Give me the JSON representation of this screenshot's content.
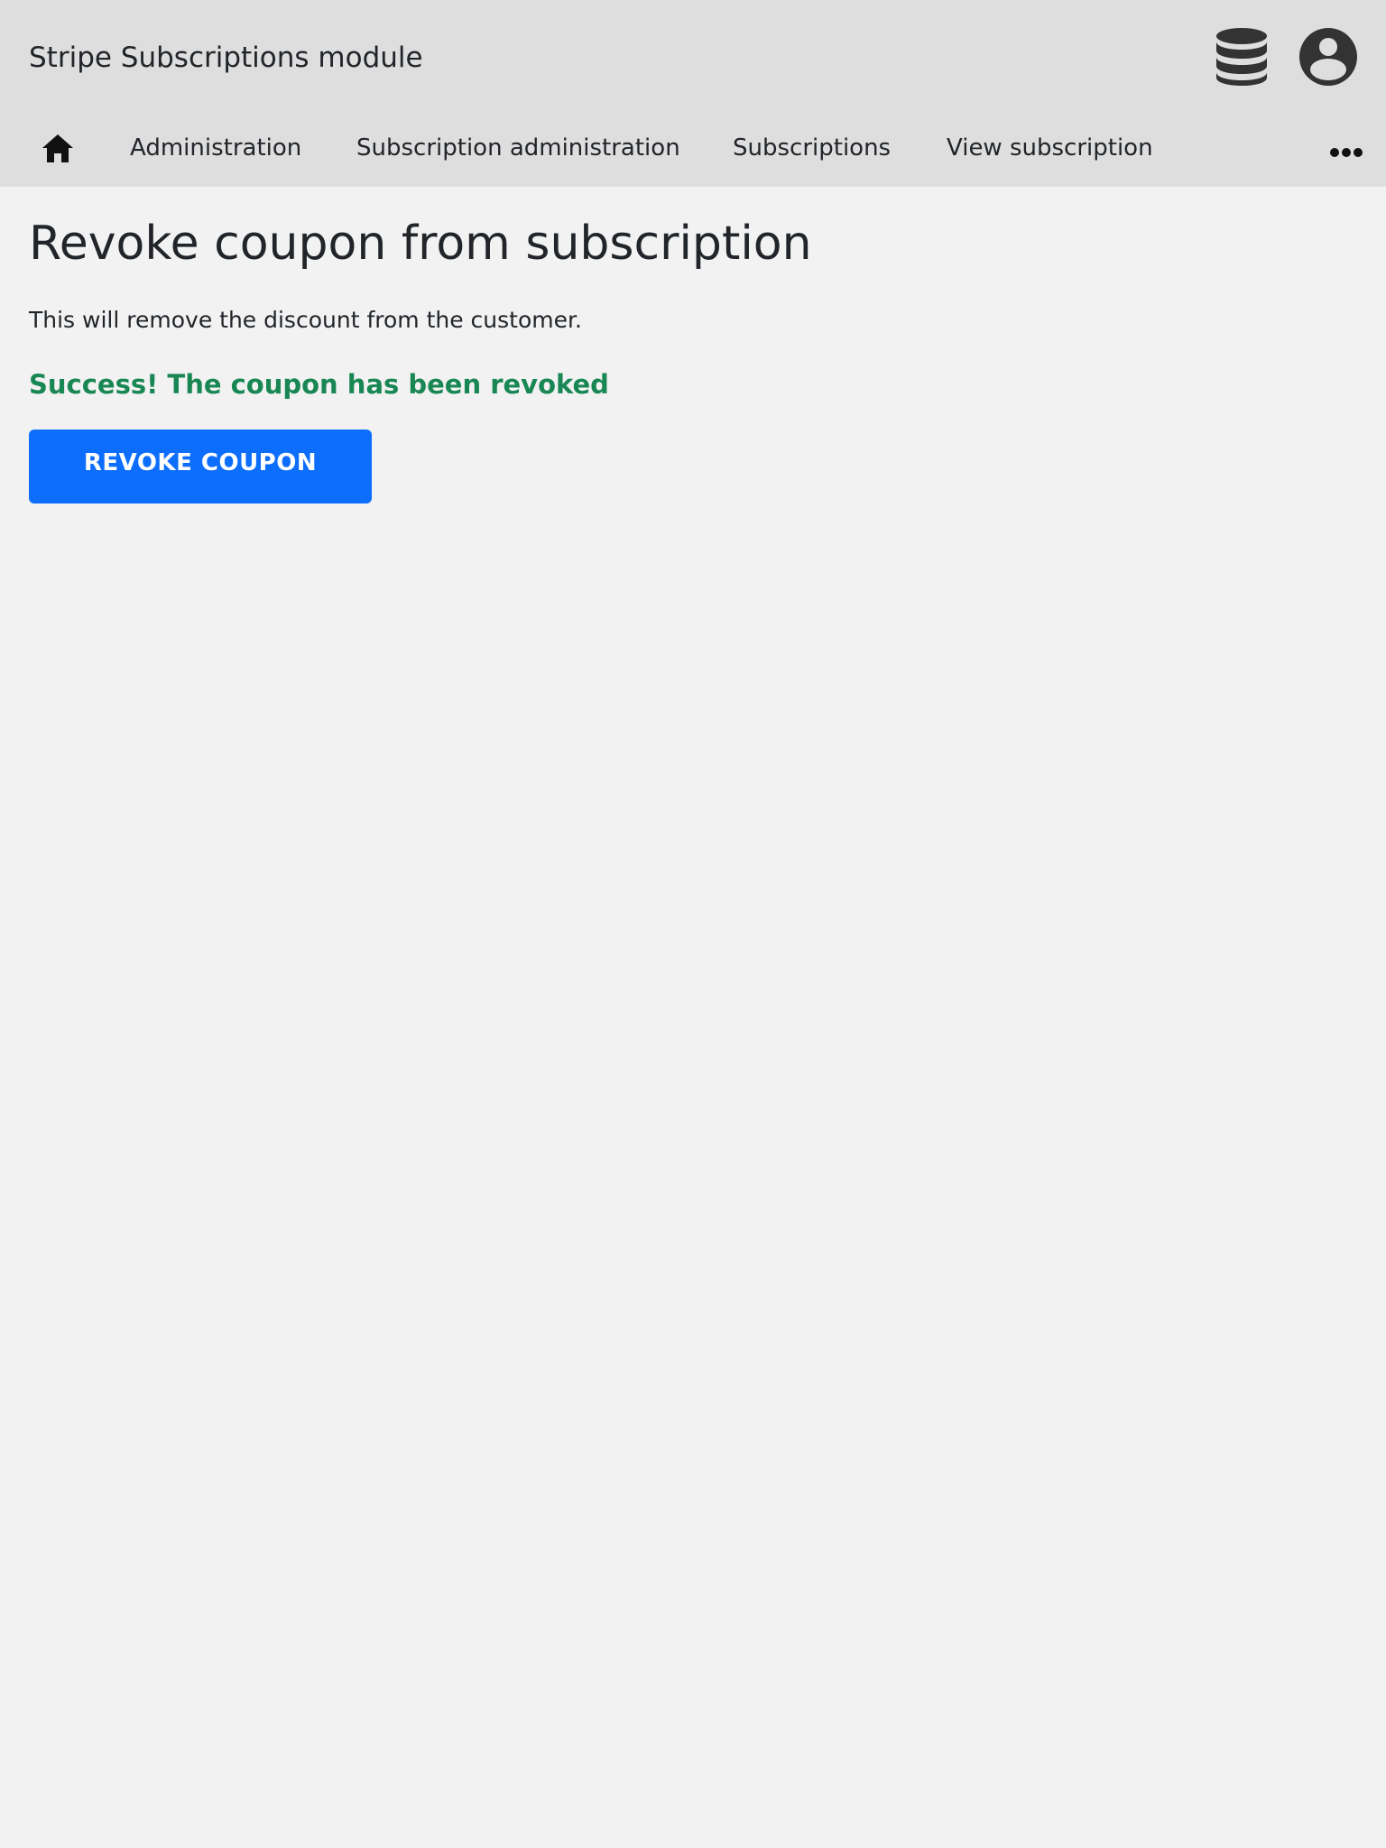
{
  "header": {
    "app_title": "Stripe Subscriptions module",
    "icons": {
      "database": "database-icon",
      "account": "user-circle-icon"
    }
  },
  "nav": {
    "home_icon": "home-icon",
    "items": [
      {
        "label": "Administration"
      },
      {
        "label": "Subscription administration"
      },
      {
        "label": "Subscriptions"
      },
      {
        "label": "View subscription"
      }
    ],
    "more_icon": "more-horizontal-icon"
  },
  "main": {
    "title": "Revoke coupon from subscription",
    "description": "This will remove the discount from the customer.",
    "success_message": "Success! The coupon has been revoked",
    "revoke_button_label": "REVOKE COUPON"
  },
  "colors": {
    "header_bg": "#dedede",
    "page_bg": "#f2f2f2",
    "text": "#212529",
    "icon": "#333333",
    "success": "#198754",
    "primary": "#0d6efd"
  }
}
